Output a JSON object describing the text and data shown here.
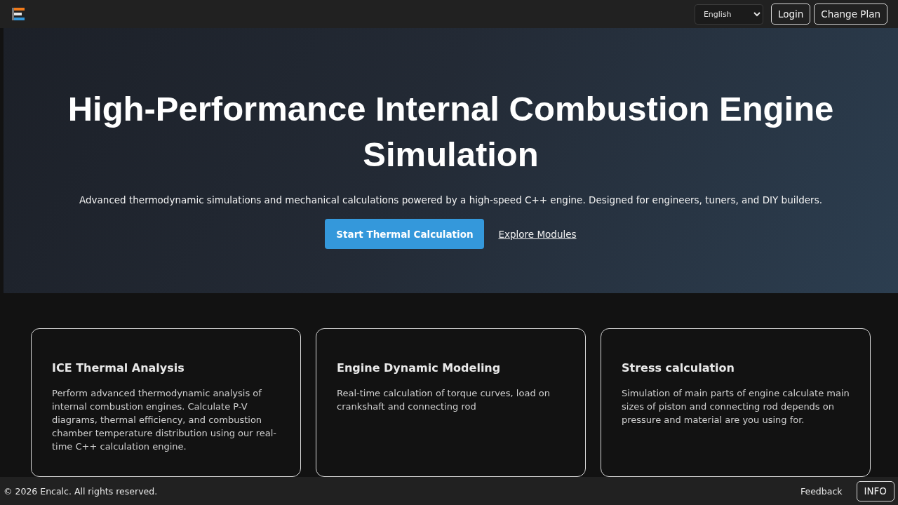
{
  "header": {
    "language": {
      "value": "English"
    },
    "buttons": [
      "Login",
      "Change Plan"
    ]
  },
  "hero": {
    "title": "High-Performance Internal Combustion Engine Simulation",
    "subtitle": "Advanced thermodynamic simulations and mechanical calculations powered by a high-speed C++ engine. Designed for engineers, tuners, and DIY builders.",
    "primary_button": "Start Thermal Calculation",
    "link": "Explore Modules"
  },
  "cards": [
    {
      "title": "ICE Thermal Analysis",
      "text": "Perform advanced thermodynamic analysis of internal combustion engines. Calculate P-V diagrams, thermal efficiency, and combustion chamber temperature distribution using our real-time C++ calculation engine."
    },
    {
      "title": "Engine Dynamic Modeling",
      "text": "Real-time calculation of torque curves, load on crankshaft and connecting rod"
    },
    {
      "title": "Stress calculation",
      "text": "Simulation of main parts of engine calculate main sizes of piston and connecting rod depends on pressure and material are you using for."
    }
  ],
  "footer": {
    "copyright": "© 2026 Encalc. All rights reserved.",
    "link": "Feedback",
    "button": "INFO"
  }
}
